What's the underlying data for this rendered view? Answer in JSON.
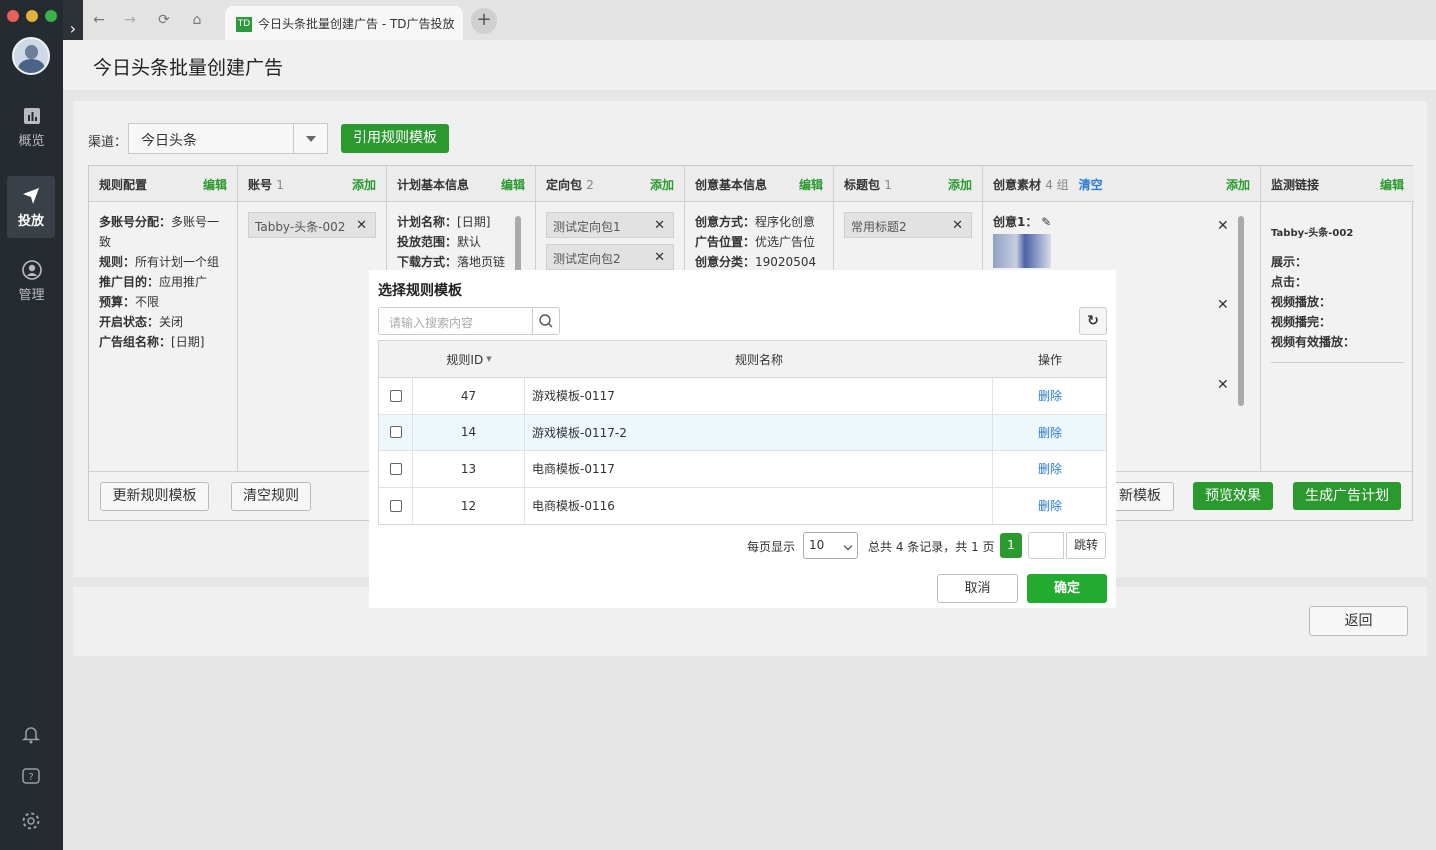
{
  "window": {
    "title": "今日头条批量创建广告 - TD广告投放",
    "tab_logo": "TD"
  },
  "page": {
    "title": "今日头条批量创建广告"
  },
  "sidebar": {
    "items": [
      {
        "label": "概览",
        "icon": "chart-icon"
      },
      {
        "label": "投放",
        "icon": "send-icon"
      },
      {
        "label": "管理",
        "icon": "user-icon"
      }
    ],
    "bottom_icons": [
      "bell-icon",
      "help-icon",
      "gear-icon"
    ]
  },
  "form": {
    "channel_label": "渠道：",
    "channel_value": "今日头条",
    "apply_template_button": "引用规则模板"
  },
  "columns": [
    {
      "title": "规则配置",
      "count": "",
      "action": "编辑"
    },
    {
      "title": "账号",
      "count": "1",
      "action": "添加"
    },
    {
      "title": "计划基本信息",
      "count": "",
      "action": "编辑"
    },
    {
      "title": "定向包",
      "count": "2",
      "action": "添加"
    },
    {
      "title": "创意基本信息",
      "count": "",
      "action": "编辑"
    },
    {
      "title": "标题包",
      "count": "1",
      "action": "添加"
    },
    {
      "title": "创意素材",
      "count": "4 组",
      "clear": "清空",
      "action": "添加"
    },
    {
      "title": "监测链接",
      "count": "",
      "action": "编辑"
    }
  ],
  "rule_config": [
    {
      "k": "多账号分配：",
      "v": "多账号一致"
    },
    {
      "k": "规则：",
      "v": "所有计划一个组"
    },
    {
      "k": "推广目的：",
      "v": "应用推广"
    },
    {
      "k": "预算：",
      "v": "不限"
    },
    {
      "k": "开启状态：",
      "v": "关闭"
    },
    {
      "k": "广告组名称：",
      "v": "[日期]"
    }
  ],
  "account_chip": "Tabby-头条-002",
  "plan_info": [
    {
      "k": "计划名称：",
      "v": "[日期]"
    },
    {
      "k": "投放范围：",
      "v": "默认"
    },
    {
      "k": "下载方式：",
      "v": "落地页链"
    }
  ],
  "targeting_chips": [
    "测试定向包1",
    "测试定向包2"
  ],
  "creative_info": [
    {
      "k": "创意方式：",
      "v": "程序化创意"
    },
    {
      "k": "广告位置：",
      "v": "优选广告位"
    },
    {
      "k": "创意分类：",
      "v": "19020504"
    }
  ],
  "title_chip": "常用标题2",
  "material": {
    "label": "创意1："
  },
  "monitor": {
    "account": "Tabby-头条-002",
    "items": [
      "展示：",
      "点击：",
      "视频播放：",
      "视频播完：",
      "视频有效播放："
    ]
  },
  "footer_buttons": {
    "update_template": "更新规则模板",
    "clear_rules": "清空规则",
    "save_template": "新模板",
    "preview": "预览效果",
    "generate": "生成广告计划",
    "back": "返回"
  },
  "modal": {
    "title": "选择规则模板",
    "search_placeholder": "请输入搜索内容",
    "headers": {
      "id": "规则ID",
      "name": "规则名称",
      "op": "操作"
    },
    "rows": [
      {
        "id": "47",
        "name": "游戏模板-0117",
        "op": "删除"
      },
      {
        "id": "14",
        "name": "游戏模板-0117-2",
        "op": "删除"
      },
      {
        "id": "13",
        "name": "电商模板-0117",
        "op": "删除"
      },
      {
        "id": "12",
        "name": "电商模板-0116",
        "op": "删除"
      }
    ],
    "pager": {
      "per_page_label": "每页显示",
      "per_page": "10",
      "summary": "总共 4 条记录，共 1 页",
      "current": "1",
      "jump": "跳转"
    },
    "cancel": "取消",
    "confirm": "确定"
  }
}
